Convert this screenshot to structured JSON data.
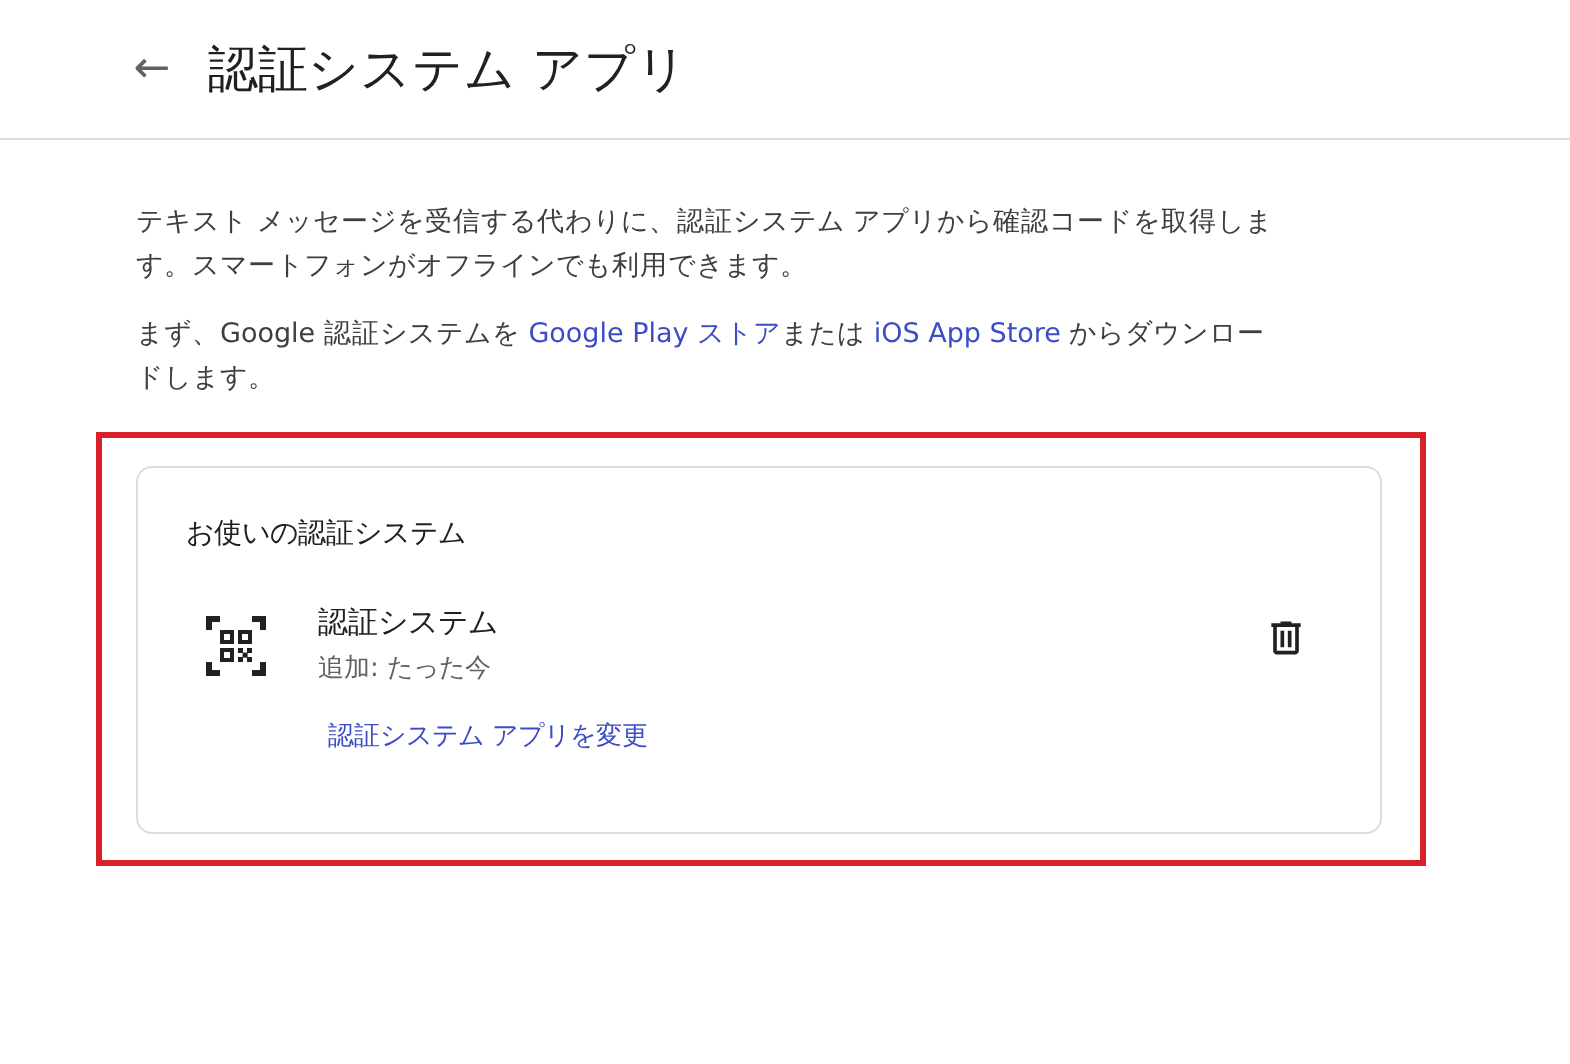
{
  "header": {
    "back_icon": "←",
    "title": "認証システム アプリ"
  },
  "paragraphs": [
    [
      {
        "kind": "text",
        "text": "テキスト メッセージを受信する代わりに、認証システム アプリから確認コードを取得します。スマートフォンがオフラインでも利用できます。"
      }
    ],
    [
      {
        "kind": "text",
        "text": "まず、Google 認証システムを "
      },
      {
        "kind": "link",
        "text": "Google Play ストア"
      },
      {
        "kind": "text",
        "text": "または "
      },
      {
        "kind": "link",
        "text": "iOS App Store"
      },
      {
        "kind": "text",
        "text": " からダウンロードします。"
      }
    ]
  ],
  "card": {
    "title": "お使いの認証システム",
    "item": {
      "name": "認証システム",
      "added": "追加: たった今",
      "change_link": "認証システム アプリを変更"
    }
  }
}
